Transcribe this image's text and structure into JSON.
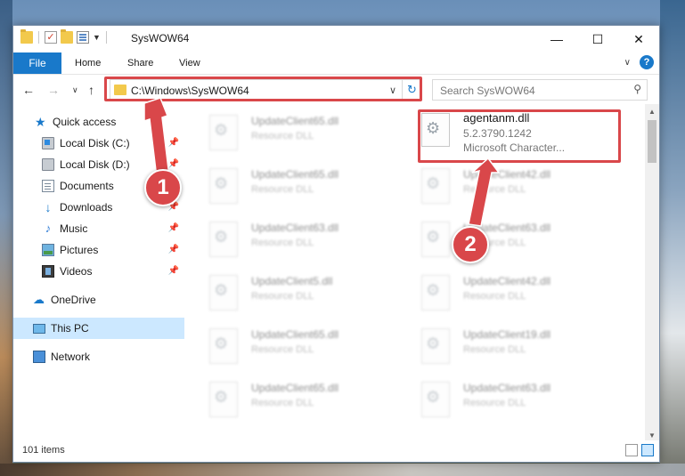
{
  "window": {
    "title": "SysWOW64"
  },
  "ribbon": {
    "tabs": [
      "File",
      "Home",
      "Share",
      "View"
    ],
    "help": "?"
  },
  "address": {
    "path": "C:\\Windows\\SysWOW64",
    "search_placeholder": "Search SysWOW64"
  },
  "sidebar": {
    "items": [
      {
        "label": "Quick access",
        "icon": "star-icon"
      },
      {
        "label": "Local Disk (C:)",
        "icon": "drive-icon",
        "pinned": true
      },
      {
        "label": "Local Disk (D:)",
        "icon": "drive-icon",
        "pinned": true
      },
      {
        "label": "Documents",
        "icon": "documents-icon",
        "pinned": true
      },
      {
        "label": "Downloads",
        "icon": "download-icon",
        "pinned": true
      },
      {
        "label": "Music",
        "icon": "music-icon",
        "pinned": true
      },
      {
        "label": "Pictures",
        "icon": "pictures-icon",
        "pinned": true
      },
      {
        "label": "Videos",
        "icon": "videos-icon",
        "pinned": true
      },
      {
        "label": "OneDrive",
        "icon": "cloud-icon"
      },
      {
        "label": "This PC",
        "icon": "computer-icon",
        "selected": true
      },
      {
        "label": "Network",
        "icon": "network-icon"
      }
    ]
  },
  "files": {
    "left": [
      {
        "name": "UpdateClient65.dll",
        "type": "Resource DLL"
      },
      {
        "name": "UpdateClient65.dll",
        "type": "Resource DLL"
      },
      {
        "name": "UpdateClient63.dll",
        "type": "Resource DLL"
      },
      {
        "name": "UpdateClient5.dll",
        "type": "Resource DLL"
      },
      {
        "name": "UpdateClient65.dll",
        "type": "Resource DLL"
      },
      {
        "name": "UpdateClient65.dll",
        "type": "Resource DLL"
      }
    ],
    "focus": {
      "name": "agentanm.dll",
      "version": "5.2.3790.1242",
      "company": "Microsoft Character..."
    },
    "right": [
      {
        "name": "UpdateClient42.dll",
        "type": "Resource DLL"
      },
      {
        "name": "UpdateClient63.dll",
        "type": "Resource DLL"
      },
      {
        "name": "UpdateClient42.dll",
        "type": "Resource DLL"
      },
      {
        "name": "UpdateClient19.dll",
        "type": "Resource DLL"
      },
      {
        "name": "UpdateClient63.dll",
        "type": "Resource DLL"
      }
    ]
  },
  "status": {
    "item_count": "101 items"
  },
  "annotations": {
    "step1": "1",
    "step2": "2",
    "color": "#d9474a"
  },
  "colors": {
    "accent": "#1979ca",
    "selection": "#cce8ff"
  }
}
